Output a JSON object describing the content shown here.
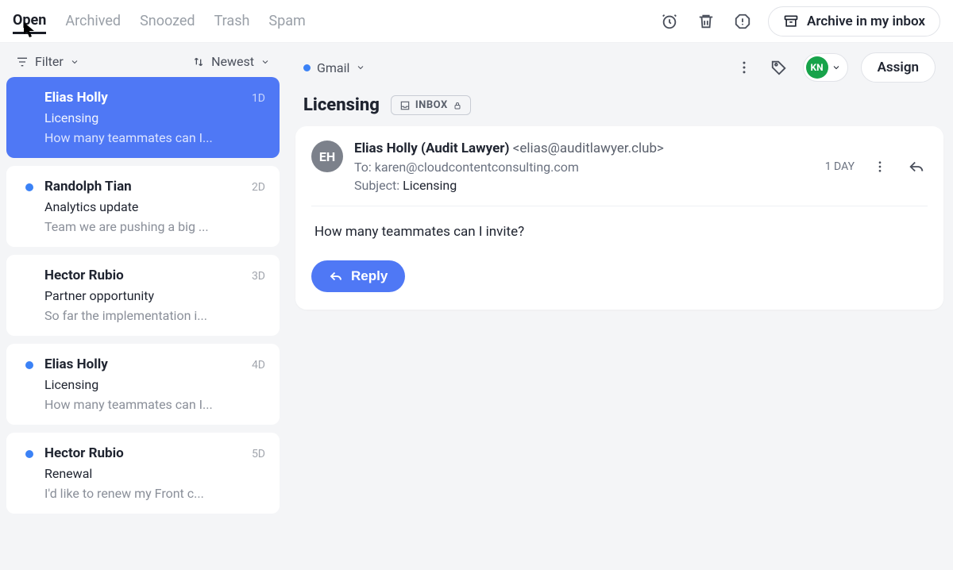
{
  "topnav": {
    "tabs": [
      "Open",
      "Archived",
      "Snoozed",
      "Trash",
      "Spam"
    ],
    "active_index": 0,
    "archive_label": "Archive in my inbox"
  },
  "list": {
    "filter_label": "Filter",
    "sort_label": "Newest",
    "conversations": [
      {
        "sender": "Elias Holly",
        "age": "1D",
        "subject": "Licensing",
        "preview": "How many teammates can I...",
        "unread": false,
        "selected": true
      },
      {
        "sender": "Randolph Tian",
        "age": "2D",
        "subject": "Analytics update",
        "preview": "Team we are pushing a big ...",
        "unread": true,
        "selected": false
      },
      {
        "sender": "Hector Rubio",
        "age": "3D",
        "subject": "Partner opportunity",
        "preview": "So far the implementation i...",
        "unread": false,
        "selected": false
      },
      {
        "sender": "Elias Holly",
        "age": "4D",
        "subject": "Licensing",
        "preview": "How many teammates can I...",
        "unread": true,
        "selected": false
      },
      {
        "sender": "Hector Rubio",
        "age": "5D",
        "subject": "Renewal",
        "preview": "I'd like to renew my Front c...",
        "unread": true,
        "selected": false
      }
    ]
  },
  "detail": {
    "source_label": "Gmail",
    "assignee_initials": "KN",
    "assign_label": "Assign",
    "title": "Licensing",
    "inbox_chip": "INBOX",
    "message": {
      "avatar_initials": "EH",
      "from_name": "Elias Holly (Audit Lawyer)",
      "from_addr": "<elias@auditlawyer.club>",
      "to_label": "To:",
      "to_value": "karen@cloudcontentconsulting.com",
      "subject_label": "Subject:",
      "subject_value": "Licensing",
      "age": "1 DAY",
      "body": "How many teammates can I invite?",
      "reply_label": "Reply"
    }
  }
}
